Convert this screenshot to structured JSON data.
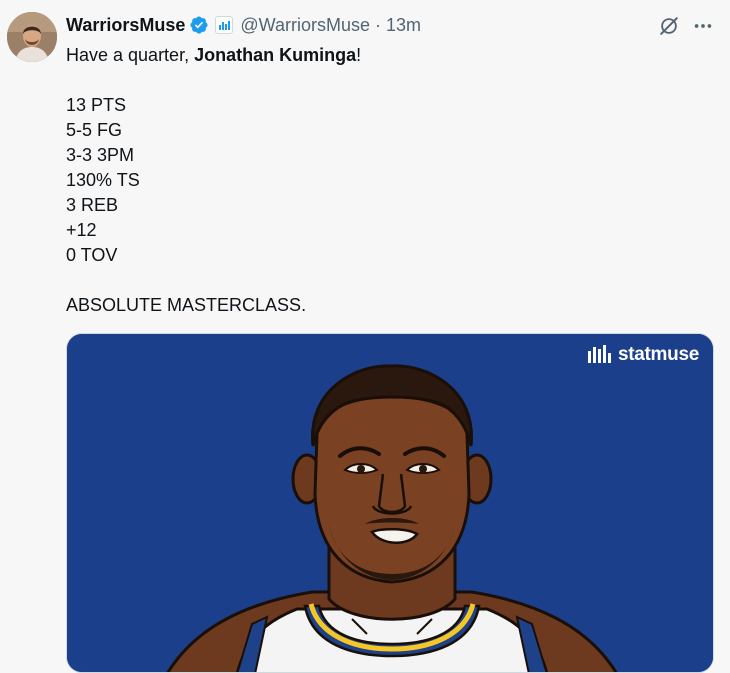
{
  "tweet": {
    "display_name": "WarriorsMuse",
    "handle": "@WarriorsMuse",
    "separator": "·",
    "time": "13m",
    "text": {
      "intro_prefix": "Have a quarter, ",
      "mention": "Jonathan Kuminga",
      "intro_suffix": "!",
      "stats": [
        "13 PTS",
        "5-5 FG",
        "3-3 3PM",
        "130% TS",
        "3 REB",
        "+12",
        "0 TOV"
      ],
      "outro": "ABSOLUTE MASTERCLASS."
    },
    "icons": {
      "verified": "verified-badge-icon",
      "affiliate": "affiliate-badge-icon",
      "grok": "grok-icon",
      "more": "more-icon"
    }
  },
  "media": {
    "brand_name": "statmuse",
    "brand_icon": "statmuse-logo-icon",
    "background_color": "#1c3f8c"
  },
  "colors": {
    "verified": "#1d9bf0",
    "text": "#0f1419",
    "secondary": "#536471"
  }
}
